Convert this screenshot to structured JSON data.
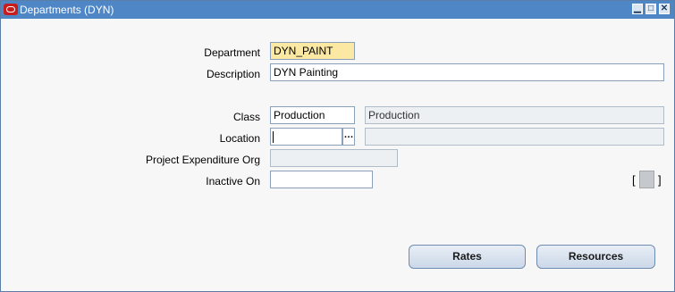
{
  "window": {
    "title": "Departments (DYN)",
    "controls": {
      "minimize": "▁",
      "maximize": "□",
      "close": "✕"
    }
  },
  "form": {
    "department": {
      "label": "Department",
      "value": "DYN_PAINT"
    },
    "description": {
      "label": "Description",
      "value": "DYN Painting"
    },
    "class": {
      "label": "Class",
      "value": "Production",
      "meaning": "Production"
    },
    "location": {
      "label": "Location",
      "value": "",
      "meaning": "",
      "lov_icon": "…"
    },
    "project_expenditure_org": {
      "label": "Project Expenditure Org",
      "value": ""
    },
    "inactive_on": {
      "label": "Inactive On",
      "value": ""
    },
    "flexfield": {
      "open": "[",
      "close": "]"
    }
  },
  "buttons": {
    "rates": "Rates",
    "resources": "Resources"
  },
  "colors": {
    "title_bar": "#4e86c6",
    "required_field": "#fbe9a3",
    "readonly_field": "#ecf0f3"
  }
}
